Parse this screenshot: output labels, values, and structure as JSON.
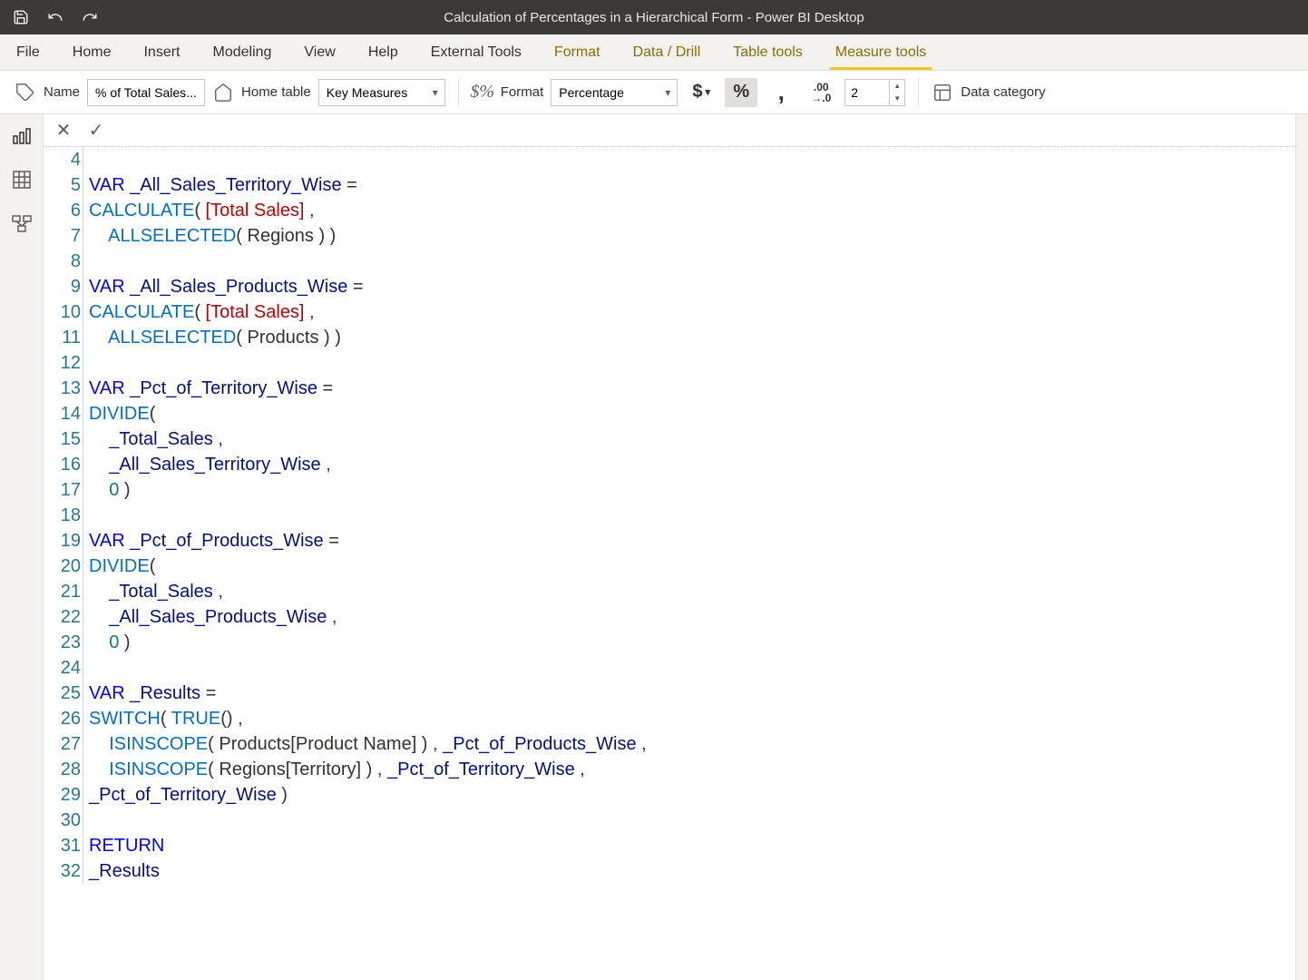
{
  "titlebar": {
    "title": "Calculation of Percentages in a Hierarchical Form - Power BI Desktop"
  },
  "ribbon": {
    "tabs": {
      "file": "File",
      "home": "Home",
      "insert": "Insert",
      "modeling": "Modeling",
      "view": "View",
      "help": "Help",
      "external": "External Tools",
      "format": "Format",
      "datadrill": "Data / Drill",
      "tabletools": "Table tools",
      "measuretools": "Measure tools"
    },
    "name_label": "Name",
    "name_value": "% of Total Sales...",
    "home_table_label": "Home table",
    "home_table_value": "Key Measures",
    "format_label": "Format",
    "format_value": "Percentage",
    "decimals_value": "2",
    "data_category_label": "Data category"
  },
  "code": {
    "first_line_num": 4,
    "lines": [
      {
        "n": 4,
        "t": []
      },
      {
        "n": 5,
        "t": [
          [
            "kw",
            "VAR"
          ],
          [
            "op",
            " "
          ],
          [
            "var",
            "_All_Sales_Territory_Wise"
          ],
          [
            "op",
            " ="
          ]
        ]
      },
      {
        "n": 6,
        "t": [
          [
            "fn",
            "CALCULATE"
          ],
          [
            "op",
            "( "
          ],
          [
            "ref",
            "[Total Sales]"
          ],
          [
            "op",
            " ,"
          ]
        ]
      },
      {
        "n": 7,
        "t": [
          [
            "op",
            "    "
          ],
          [
            "fn",
            "ALLSELECTED"
          ],
          [
            "op",
            "( Regions ) )"
          ]
        ]
      },
      {
        "n": 8,
        "t": []
      },
      {
        "n": 9,
        "t": [
          [
            "kw",
            "VAR"
          ],
          [
            "op",
            " "
          ],
          [
            "var",
            "_All_Sales_Products_Wise"
          ],
          [
            "op",
            " ="
          ]
        ]
      },
      {
        "n": 10,
        "t": [
          [
            "fn",
            "CALCULATE"
          ],
          [
            "op",
            "( "
          ],
          [
            "ref",
            "[Total Sales]"
          ],
          [
            "op",
            " ,"
          ]
        ]
      },
      {
        "n": 11,
        "t": [
          [
            "op",
            "    "
          ],
          [
            "fn",
            "ALLSELECTED"
          ],
          [
            "op",
            "( Products ) )"
          ]
        ]
      },
      {
        "n": 12,
        "t": []
      },
      {
        "n": 13,
        "t": [
          [
            "kw",
            "VAR"
          ],
          [
            "op",
            " "
          ],
          [
            "var",
            "_Pct_of_Territory_Wise"
          ],
          [
            "op",
            " ="
          ]
        ]
      },
      {
        "n": 14,
        "t": [
          [
            "fn",
            "DIVIDE"
          ],
          [
            "op",
            "("
          ]
        ]
      },
      {
        "n": 15,
        "t": [
          [
            "op",
            "    "
          ],
          [
            "var",
            "_Total_Sales"
          ],
          [
            "op",
            " ,"
          ]
        ]
      },
      {
        "n": 16,
        "t": [
          [
            "op",
            "    "
          ],
          [
            "var",
            "_All_Sales_Territory_Wise"
          ],
          [
            "op",
            " ,"
          ]
        ]
      },
      {
        "n": 17,
        "t": [
          [
            "op",
            "    "
          ],
          [
            "num",
            "0"
          ],
          [
            "op",
            " )"
          ]
        ]
      },
      {
        "n": 18,
        "t": []
      },
      {
        "n": 19,
        "t": [
          [
            "kw",
            "VAR"
          ],
          [
            "op",
            " "
          ],
          [
            "var",
            "_Pct_of_Products_Wise"
          ],
          [
            "op",
            " ="
          ]
        ]
      },
      {
        "n": 20,
        "t": [
          [
            "fn",
            "DIVIDE"
          ],
          [
            "op",
            "("
          ]
        ]
      },
      {
        "n": 21,
        "t": [
          [
            "op",
            "    "
          ],
          [
            "var",
            "_Total_Sales"
          ],
          [
            "op",
            " ,"
          ]
        ]
      },
      {
        "n": 22,
        "t": [
          [
            "op",
            "    "
          ],
          [
            "var",
            "_All_Sales_Products_Wise"
          ],
          [
            "op",
            " ,"
          ]
        ]
      },
      {
        "n": 23,
        "t": [
          [
            "op",
            "    "
          ],
          [
            "num",
            "0"
          ],
          [
            "op",
            " )"
          ]
        ]
      },
      {
        "n": 24,
        "t": []
      },
      {
        "n": 25,
        "t": [
          [
            "kw",
            "VAR"
          ],
          [
            "op",
            " "
          ],
          [
            "var",
            "_Results"
          ],
          [
            "op",
            " ="
          ]
        ]
      },
      {
        "n": 26,
        "t": [
          [
            "fn",
            "SWITCH"
          ],
          [
            "op",
            "( "
          ],
          [
            "fn",
            "TRUE"
          ],
          [
            "op",
            "() ,"
          ]
        ]
      },
      {
        "n": 27,
        "t": [
          [
            "op",
            "    "
          ],
          [
            "fn",
            "ISINSCOPE"
          ],
          [
            "op",
            "( Products[Product Name] ) , "
          ],
          [
            "var",
            "_Pct_of_Products_Wise"
          ],
          [
            "op",
            " ,"
          ]
        ]
      },
      {
        "n": 28,
        "t": [
          [
            "op",
            "    "
          ],
          [
            "fn",
            "ISINSCOPE"
          ],
          [
            "op",
            "( Regions[Territory] ) , "
          ],
          [
            "var",
            "_Pct_of_Territory_Wise"
          ],
          [
            "op",
            " ,"
          ]
        ]
      },
      {
        "n": 29,
        "t": [
          [
            "var",
            "_Pct_of_Territory_Wise"
          ],
          [
            "op",
            " )"
          ]
        ]
      },
      {
        "n": 30,
        "t": []
      },
      {
        "n": 31,
        "t": [
          [
            "kw",
            "RETURN"
          ]
        ]
      },
      {
        "n": 32,
        "t": [
          [
            "var",
            "_Results"
          ]
        ]
      }
    ]
  }
}
